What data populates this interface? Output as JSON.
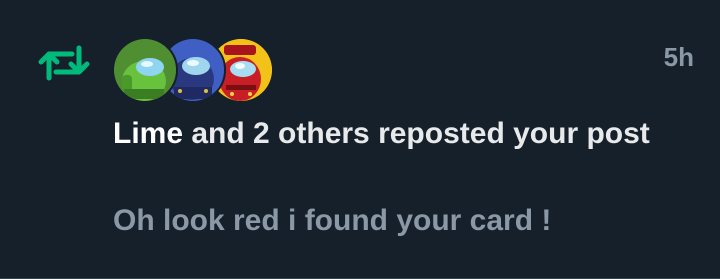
{
  "notification": {
    "type": "repost",
    "icon": "repost-icon",
    "accent_color": "#00ba7c",
    "timestamp": "5h",
    "actor_name": "Lime",
    "action_text": " and 2 others reposted your post",
    "post_preview": "Oh look red i found your card !",
    "avatars": [
      {
        "name": "lime-crewmate-avatar",
        "color": "#5bb33b"
      },
      {
        "name": "navy-crewmate-avatar",
        "color": "#3a4fb0"
      },
      {
        "name": "red-crewmate-avatar",
        "color": "#d7262b"
      }
    ]
  }
}
